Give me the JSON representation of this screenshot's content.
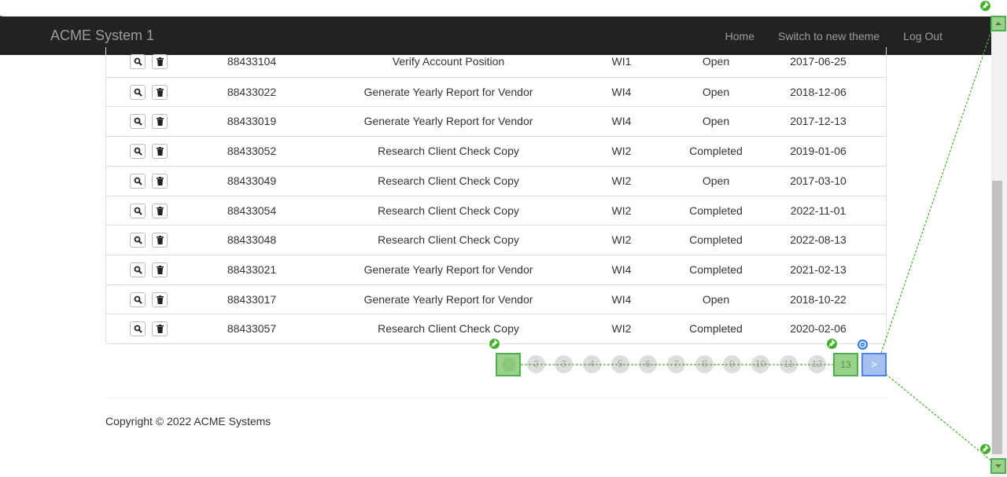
{
  "navbar": {
    "brand": "ACME System 1",
    "links": [
      "Home",
      "Switch to new theme",
      "Log Out"
    ]
  },
  "table": {
    "rows": [
      {
        "id": "88433104",
        "title": "Verify Account Position",
        "type": "WI1",
        "status": "Open",
        "date": "2017-06-25"
      },
      {
        "id": "88433022",
        "title": "Generate Yearly Report for Vendor",
        "type": "WI4",
        "status": "Open",
        "date": "2018-12-06"
      },
      {
        "id": "88433019",
        "title": "Generate Yearly Report for Vendor",
        "type": "WI4",
        "status": "Open",
        "date": "2017-12-13"
      },
      {
        "id": "88433052",
        "title": "Research Client Check Copy",
        "type": "WI2",
        "status": "Completed",
        "date": "2019-01-06"
      },
      {
        "id": "88433049",
        "title": "Research Client Check Copy",
        "type": "WI2",
        "status": "Open",
        "date": "2017-03-10"
      },
      {
        "id": "88433054",
        "title": "Research Client Check Copy",
        "type": "WI2",
        "status": "Completed",
        "date": "2022-11-01"
      },
      {
        "id": "88433048",
        "title": "Research Client Check Copy",
        "type": "WI2",
        "status": "Completed",
        "date": "2022-08-13"
      },
      {
        "id": "88433021",
        "title": "Generate Yearly Report for Vendor",
        "type": "WI4",
        "status": "Completed",
        "date": "2021-02-13"
      },
      {
        "id": "88433017",
        "title": "Generate Yearly Report for Vendor",
        "type": "WI4",
        "status": "Open",
        "date": "2018-10-22"
      },
      {
        "id": "88433057",
        "title": "Research Client Check Copy",
        "type": "WI2",
        "status": "Completed",
        "date": "2020-02-06"
      }
    ]
  },
  "pagination": {
    "pages": [
      "2",
      "3",
      "4",
      "5",
      "6",
      "7",
      "8",
      "9",
      "10",
      "11",
      "12"
    ],
    "last": "13",
    "next": ">"
  },
  "footer": {
    "copyright": "Copyright © 2022 ACME Systems"
  },
  "icons": {
    "row_actions": [
      "search-icon",
      "trash-icon"
    ],
    "markers": [
      "pin-icon",
      "target-icon"
    ]
  },
  "colors": {
    "navbar_bg": "#222222",
    "nav_text": "#9d9d9d",
    "highlight_green": "#4caf50",
    "highlight_blue": "#4a86e8"
  }
}
